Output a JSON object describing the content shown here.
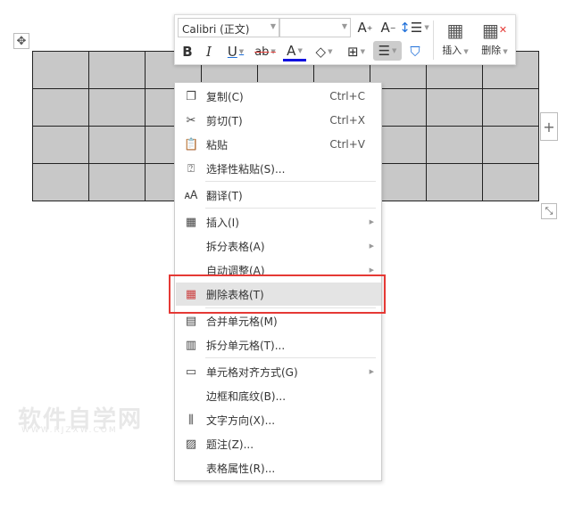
{
  "toolbar": {
    "font_name": "Calibri (正文)",
    "font_size": "",
    "insert_label": "插入",
    "delete_label": "删除"
  },
  "menu": {
    "items": [
      {
        "label": "复制(C)",
        "shortcut": "Ctrl+C",
        "icon": "copy-icon"
      },
      {
        "label": "剪切(T)",
        "shortcut": "Ctrl+X",
        "icon": "scissors-icon"
      },
      {
        "label": "粘贴",
        "shortcut": "Ctrl+V",
        "icon": "paste-icon"
      },
      {
        "label": "选择性粘贴(S)...",
        "icon": "paste-special-icon"
      },
      {
        "label": "翻译(T)",
        "icon": "translate-icon"
      },
      {
        "label": "插入(I)",
        "icon": "table-insert-icon",
        "submenu": true
      },
      {
        "label": "拆分表格(A)",
        "submenu": true
      },
      {
        "label": "自动调整(A)",
        "submenu": true
      },
      {
        "label": "删除表格(T)",
        "icon": "table-delete-icon",
        "highlighted": true
      },
      {
        "label": "合并单元格(M)",
        "icon": "merge-cells-icon"
      },
      {
        "label": "拆分单元格(T)...",
        "icon": "split-cells-icon"
      },
      {
        "label": "单元格对齐方式(G)",
        "icon": "cell-align-icon",
        "submenu": true
      },
      {
        "label": "边框和底纹(B)..."
      },
      {
        "label": "文字方向(X)...",
        "icon": "text-direction-icon"
      },
      {
        "label": "题注(Z)...",
        "icon": "caption-icon"
      },
      {
        "label": "表格属性(R)..."
      }
    ]
  },
  "watermark": {
    "title": "软件自学网",
    "url": "WWW.RJZXW.COM"
  },
  "colors": {
    "highlight_box": "#e53935",
    "cell_fill": "#c8c8c8",
    "accent": "#1e6fd9"
  }
}
